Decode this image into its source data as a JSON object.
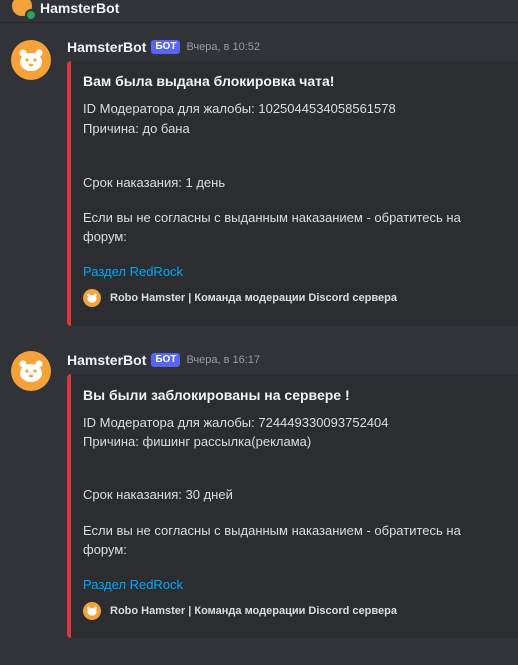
{
  "channel": {
    "name": "HamsterBot"
  },
  "messages": [
    {
      "username": "HamsterBot",
      "tag": "БОТ",
      "timestamp": "Вчера, в 10:52",
      "embed": {
        "title": "Вам была выдана блокировка чата!",
        "moderator_line": "ID Модератора для жалобы: 1025044534058561578",
        "reason_line": "Причина: до бана",
        "term_line": "Срок наказания: 1 день",
        "appeal_line_1": "Если вы не согласны с выданным наказанием - обратитесь на",
        "appeal_line_2": "форум:",
        "link": "Раздел RedRock",
        "footer": "Robo Hamster | Команда модерации Discord сервера"
      }
    },
    {
      "username": "HamsterBot",
      "tag": "БОТ",
      "timestamp": "Вчера, в 16:17",
      "embed": {
        "title": "Вы были заблокированы на сервере !",
        "moderator_line": "ID Модератора для жалобы: 724449330093752404",
        "reason_line": "Причина: фишинг рассылка(реклама)",
        "term_line": "Срок наказания: 30 дней",
        "appeal_line_1": "Если вы не согласны с выданным наказанием - обратитесь на",
        "appeal_line_2": "форум:",
        "link": "Раздел RedRock",
        "footer": "Robo Hamster | Команда модерации Discord сервера"
      }
    }
  ],
  "colors": {
    "embed_border": "#da373c",
    "bot_tag": "#5865f2",
    "link": "#00a8fc",
    "avatar": "#f5a23a"
  },
  "icons": {
    "avatar": "hamster-icon",
    "status": "online-status-icon"
  }
}
